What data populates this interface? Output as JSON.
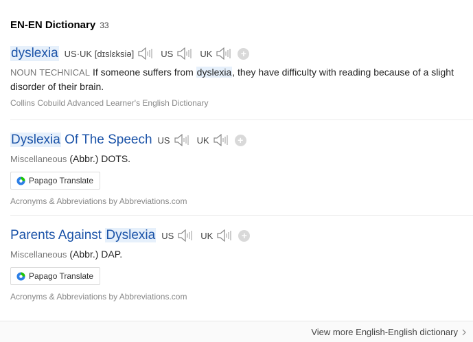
{
  "section": {
    "title": "EN-EN Dictionary",
    "count": "33"
  },
  "entries": [
    {
      "headword": "dyslexia",
      "pron_label": "US·UK [dɪslɛksiə]",
      "us_label": "US",
      "uk_label": "UK",
      "pos": "NOUN",
      "field": "TECHNICAL",
      "def_before": "If someone suffers from ",
      "def_highlight": "dyslexia",
      "def_after": ", they have difficulty with reading because of a slight disorder of their brain.",
      "source": "Collins Cobuild Advanced Learner's English Dictionary"
    },
    {
      "headword_highlight": "Dyslexia",
      "headword_rest": " Of The Speech",
      "us_label": "US",
      "uk_label": "UK",
      "category": "Miscellaneous",
      "definition": "(Abbr.) DOTS.",
      "translate_label": "Papago Translate",
      "source": "Acronyms & Abbreviations by Abbreviations.com"
    },
    {
      "headword_rest": "Parents Against ",
      "headword_highlight": "Dyslexia",
      "us_label": "US",
      "uk_label": "UK",
      "category": "Miscellaneous",
      "definition": "(Abbr.) DAP.",
      "translate_label": "Papago Translate",
      "source": "Acronyms & Abbreviations by Abbreviations.com"
    }
  ],
  "footer": {
    "view_more": "View more English-English dictionary"
  },
  "colors": {
    "headword": "#1b53a8",
    "highlight_bg": "#e6f0fb",
    "papago_green": "#1ec800",
    "papago_blue": "#2d7fe6"
  }
}
